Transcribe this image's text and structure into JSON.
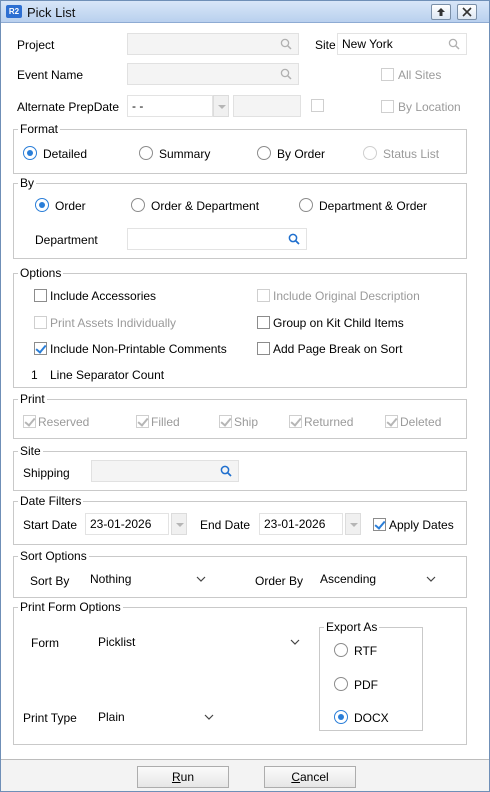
{
  "window": {
    "title": "Pick List",
    "app_badge": "R2"
  },
  "fields": {
    "project_label": "Project",
    "project_value": "",
    "site_label": "Site",
    "site_value": "New York",
    "event_label": "Event Name",
    "event_value": "",
    "all_sites_label": "All Sites",
    "alt_prep_label": "Alternate PrepDate",
    "alt_prep_value": "- -",
    "by_location_label": "By Location"
  },
  "format": {
    "legend": "Format",
    "options": [
      "Detailed",
      "Summary",
      "By Order",
      "Status List"
    ],
    "selected": "Detailed"
  },
  "by": {
    "legend": "By",
    "options": [
      "Order",
      "Order & Department",
      "Department & Order"
    ],
    "selected": "Order",
    "department_label": "Department",
    "department_value": ""
  },
  "options": {
    "legend": "Options",
    "include_accessories": "Include Accessories",
    "include_original_description": "Include Original Description",
    "print_assets_individually": "Print Assets Individually",
    "group_on_kit_child_items": "Group on Kit Child Items",
    "include_non_printable_comments": "Include Non-Printable Comments",
    "add_page_break_on_sort": "Add Page Break on Sort",
    "line_separator_count_value": "1",
    "line_separator_count_label": "Line Separator Count"
  },
  "print": {
    "legend": "Print",
    "items": [
      "Reserved",
      "Filled",
      "Ship",
      "Returned",
      "Deleted"
    ]
  },
  "site": {
    "legend": "Site",
    "shipping_label": "Shipping",
    "shipping_value": ""
  },
  "date_filters": {
    "legend": "Date Filters",
    "start_label": "Start Date",
    "start_value": "23-01-2026",
    "end_label": "End Date",
    "end_value": "23-01-2026",
    "apply_label": "Apply Dates"
  },
  "sort": {
    "legend": "Sort Options",
    "sort_by_label": "Sort By",
    "sort_by_value": "Nothing",
    "order_by_label": "Order By",
    "order_by_value": "Ascending"
  },
  "print_form": {
    "legend": "Print Form Options",
    "form_label": "Form",
    "form_value": "Picklist",
    "print_type_label": "Print Type",
    "print_type_value": "Plain",
    "export_legend": "Export As",
    "export_options": [
      "RTF",
      "PDF",
      "DOCX"
    ],
    "export_selected": "DOCX"
  },
  "buttons": {
    "run_first": "R",
    "run_rest": "un",
    "cancel_first": "C",
    "cancel_rest": "ancel"
  },
  "colors": {
    "accent": "#2a7ed8",
    "title_bar": "#c9dcf3"
  }
}
